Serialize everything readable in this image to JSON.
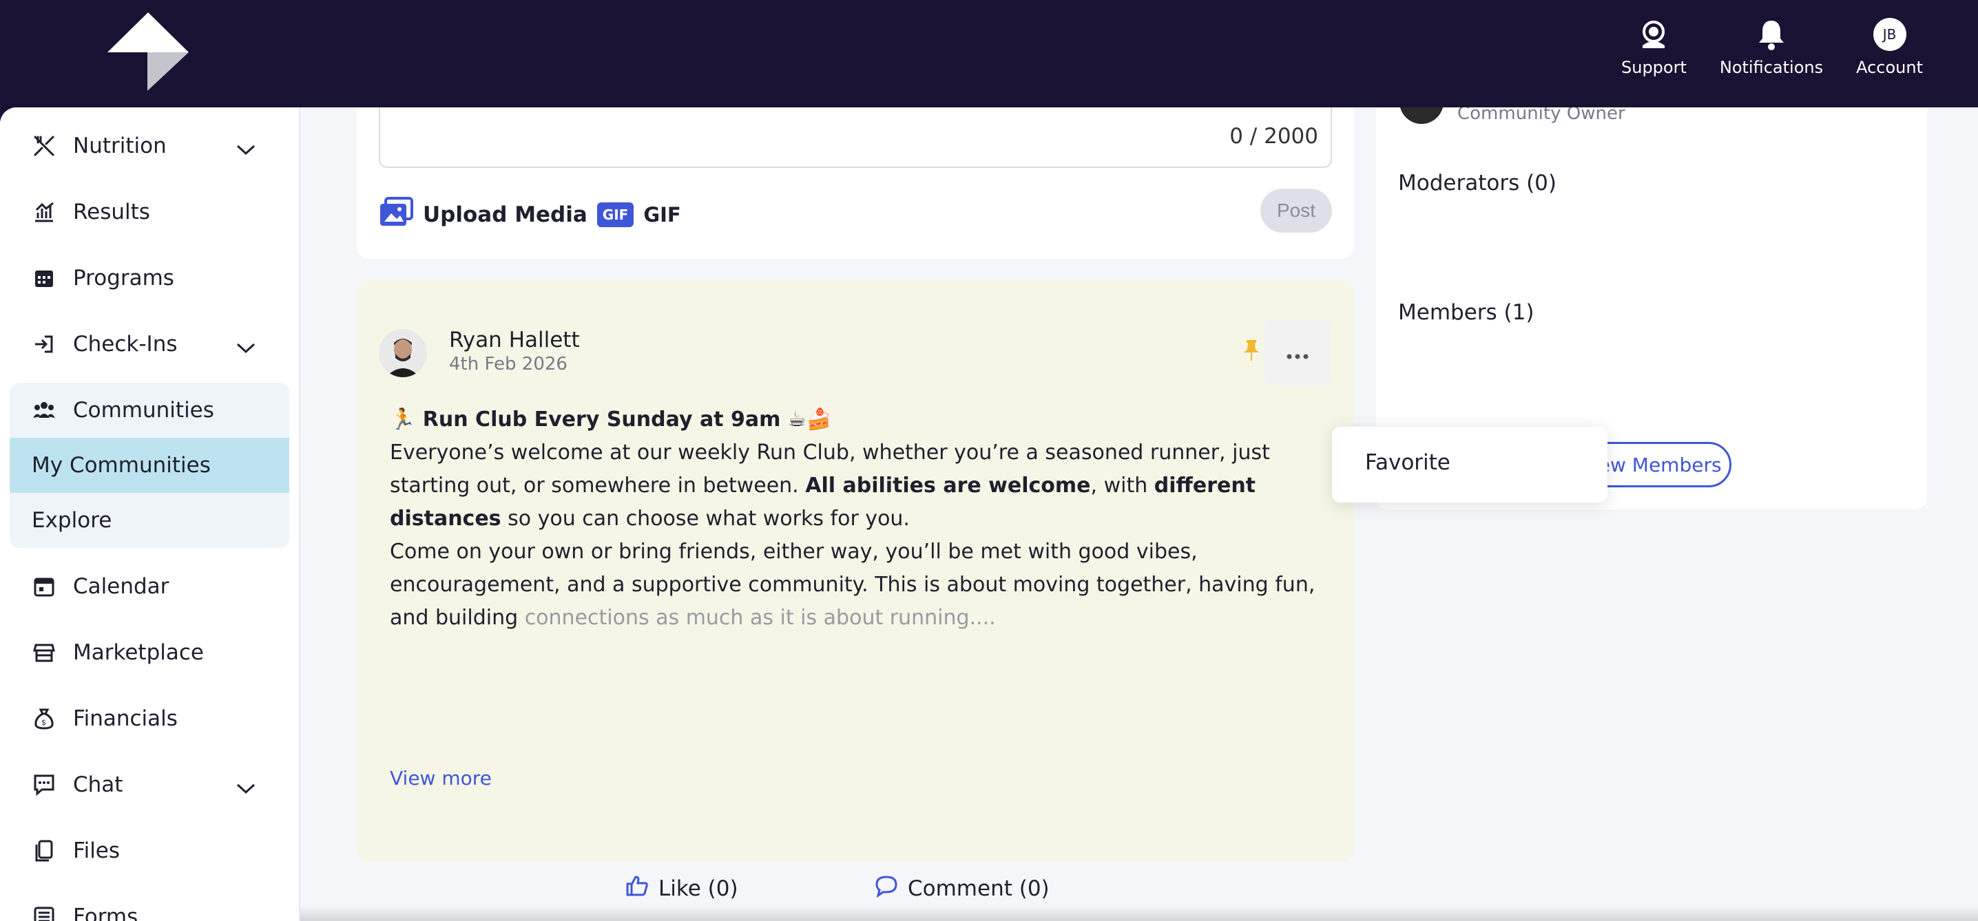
{
  "header": {
    "support_label": "Support",
    "notifications_label": "Notifications",
    "account_label": "Account",
    "account_initials": "JB"
  },
  "sidebar": {
    "items": [
      {
        "label": "Nutrition",
        "icon": "utensils-icon",
        "expandable": true
      },
      {
        "label": "Results",
        "icon": "chart-icon",
        "expandable": false
      },
      {
        "label": "Programs",
        "icon": "calendar-grid-icon",
        "expandable": false
      },
      {
        "label": "Check-Ins",
        "icon": "login-icon",
        "expandable": true
      },
      {
        "label": "Communities",
        "icon": "users-icon",
        "expandable": false
      },
      {
        "label": "Calendar",
        "icon": "calendar-icon",
        "expandable": false
      },
      {
        "label": "Marketplace",
        "icon": "store-icon",
        "expandable": false
      },
      {
        "label": "Financials",
        "icon": "money-bag-icon",
        "expandable": false
      },
      {
        "label": "Chat",
        "icon": "chat-icon",
        "expandable": true
      },
      {
        "label": "Files",
        "icon": "files-icon",
        "expandable": false
      },
      {
        "label": "Forms",
        "icon": "forms-icon",
        "expandable": false
      }
    ],
    "communities_sub": [
      "My Communities",
      "Explore"
    ]
  },
  "composer": {
    "char_count": "0 / 2000",
    "upload_label": "Upload Media",
    "gif_badge": "GIF",
    "gif_label": "GIF",
    "post_label": "Post"
  },
  "post": {
    "author": "Ryan Hallett",
    "date": "4th Feb 2026",
    "title": "🏃 Run Club Every Sunday at 9am ☕🍰",
    "p1_a": "Everyone’s welcome at our weekly Run Club, whether you’re a seasoned runner, just starting out, or somewhere in between. ",
    "p1_b": "All abilities are welcome",
    "p1_c": ", with ",
    "p1_d": "different distances",
    "p1_e": " so you can choose what works for you.",
    "p2_a": "Come on your own or bring friends, either way, you’ll be met with good vibes, encouragement, and a supportive community. This is about moving together, having fun, and building ",
    "p2_b": "connections as much as it is about running....",
    "view_more": "View more",
    "like_label": "Like (0)",
    "comment_label": "Comment (0)"
  },
  "right_panel": {
    "owner_role": "Community Owner",
    "moderators_title": "Moderators (0)",
    "members_title": "Members (1)",
    "view_members_label": "View Members"
  },
  "dropdown": {
    "favorite_label": "Favorite"
  },
  "colors": {
    "topbar": "#1a1233",
    "accent": "#3f56d8",
    "active_sub": "#bde3f0",
    "post_bg": "#f6f6e6",
    "pin": "#f2b631"
  }
}
